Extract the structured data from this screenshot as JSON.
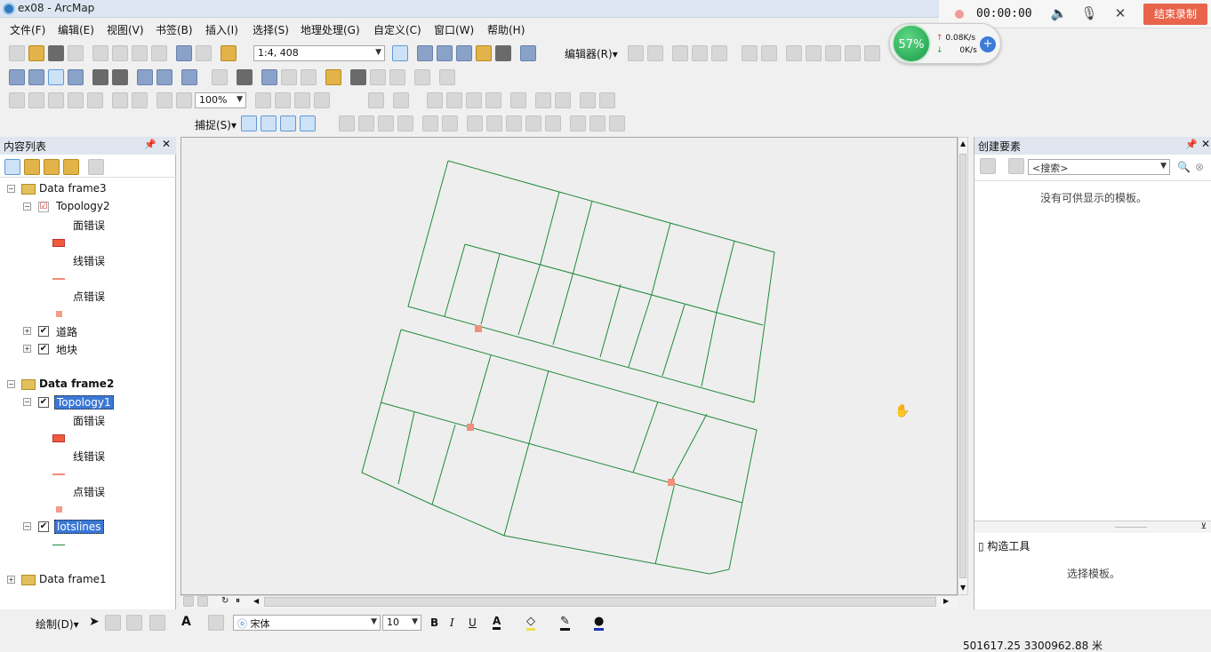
{
  "window": {
    "title": "ex08 - ArcMap"
  },
  "recorder": {
    "time": "00:00:00",
    "stop_label": "结束录制"
  },
  "net_widget": {
    "percent": "57%",
    "up": "0.08K/s",
    "down": "0K/s"
  },
  "menu": [
    "文件(F)",
    "编辑(E)",
    "视图(V)",
    "书签(B)",
    "插入(I)",
    "选择(S)",
    "地理处理(G)",
    "自定义(C)",
    "窗口(W)",
    "帮助(H)"
  ],
  "toolbar": {
    "scale": "1:4, 408",
    "editor_label": "编辑器(R)▾",
    "zoom_pct": "100%",
    "snap_label": "捕捉(S)▾"
  },
  "toc": {
    "title": "内容列表",
    "frame3": {
      "name": "Data frame3",
      "topology": "Topology2",
      "legend": [
        "面错误",
        "线错误",
        "点错误"
      ],
      "layers": [
        "道路",
        "地块"
      ]
    },
    "frame2": {
      "name": "Data frame2",
      "topology": "Topology1",
      "legend": [
        "面错误",
        "线错误",
        "点错误"
      ],
      "layer": "lotslines"
    },
    "frame1": {
      "name": "Data frame1"
    }
  },
  "create_features": {
    "title": "创建要素",
    "search_placeholder": "<搜索>",
    "empty_message": "没有可供显示的模板。",
    "construct_title": "构造工具",
    "construct_message": "选择模板。"
  },
  "drawbar": {
    "draw_label": "绘制(D)▾",
    "font": "宋体",
    "size": "10"
  },
  "status": {
    "coords": "501617.25  3300962.88 米"
  },
  "colors": {
    "lines": "#1f8a3c",
    "error_point": "#f0907c",
    "selection": "#3b78d6",
    "rec_button": "#e8644a",
    "speed_ball": "#23a852"
  }
}
